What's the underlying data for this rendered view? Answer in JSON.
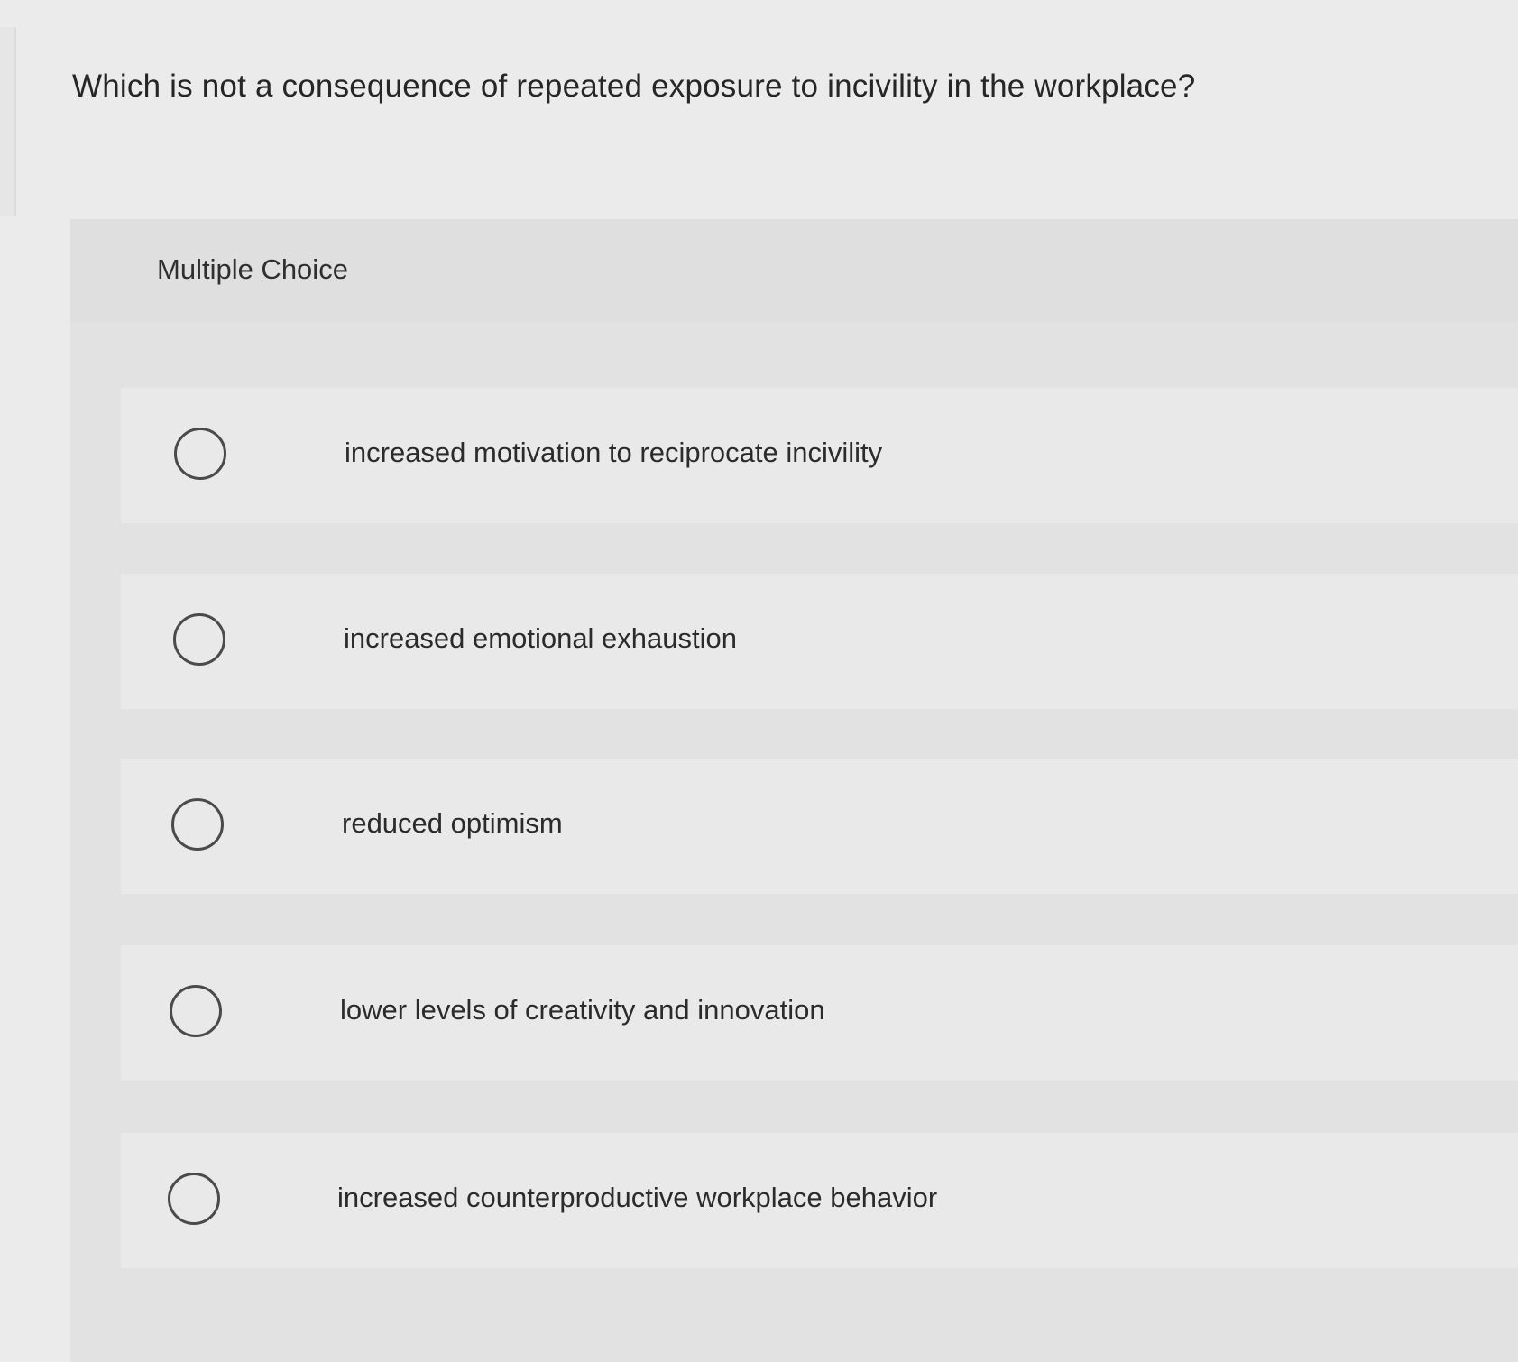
{
  "question": {
    "text": "Which is not a consequence of repeated exposure to incivility in the workplace?"
  },
  "question_type": {
    "label": "Multiple Choice"
  },
  "choices": [
    {
      "label": "increased motivation to reciprocate incivility",
      "selected": false
    },
    {
      "label": "increased emotional exhaustion",
      "selected": false
    },
    {
      "label": "reduced optimism",
      "selected": false
    },
    {
      "label": "lower levels of creativity and innovation",
      "selected": false
    },
    {
      "label": "increased counterproductive workplace behavior",
      "selected": false
    }
  ],
  "colors": {
    "background": "#ebebeb",
    "panel": "#e2e2e2",
    "choice_row": "#e9e9e9",
    "text": "#2b2b2b",
    "radio_border": "#4a4a4a"
  }
}
